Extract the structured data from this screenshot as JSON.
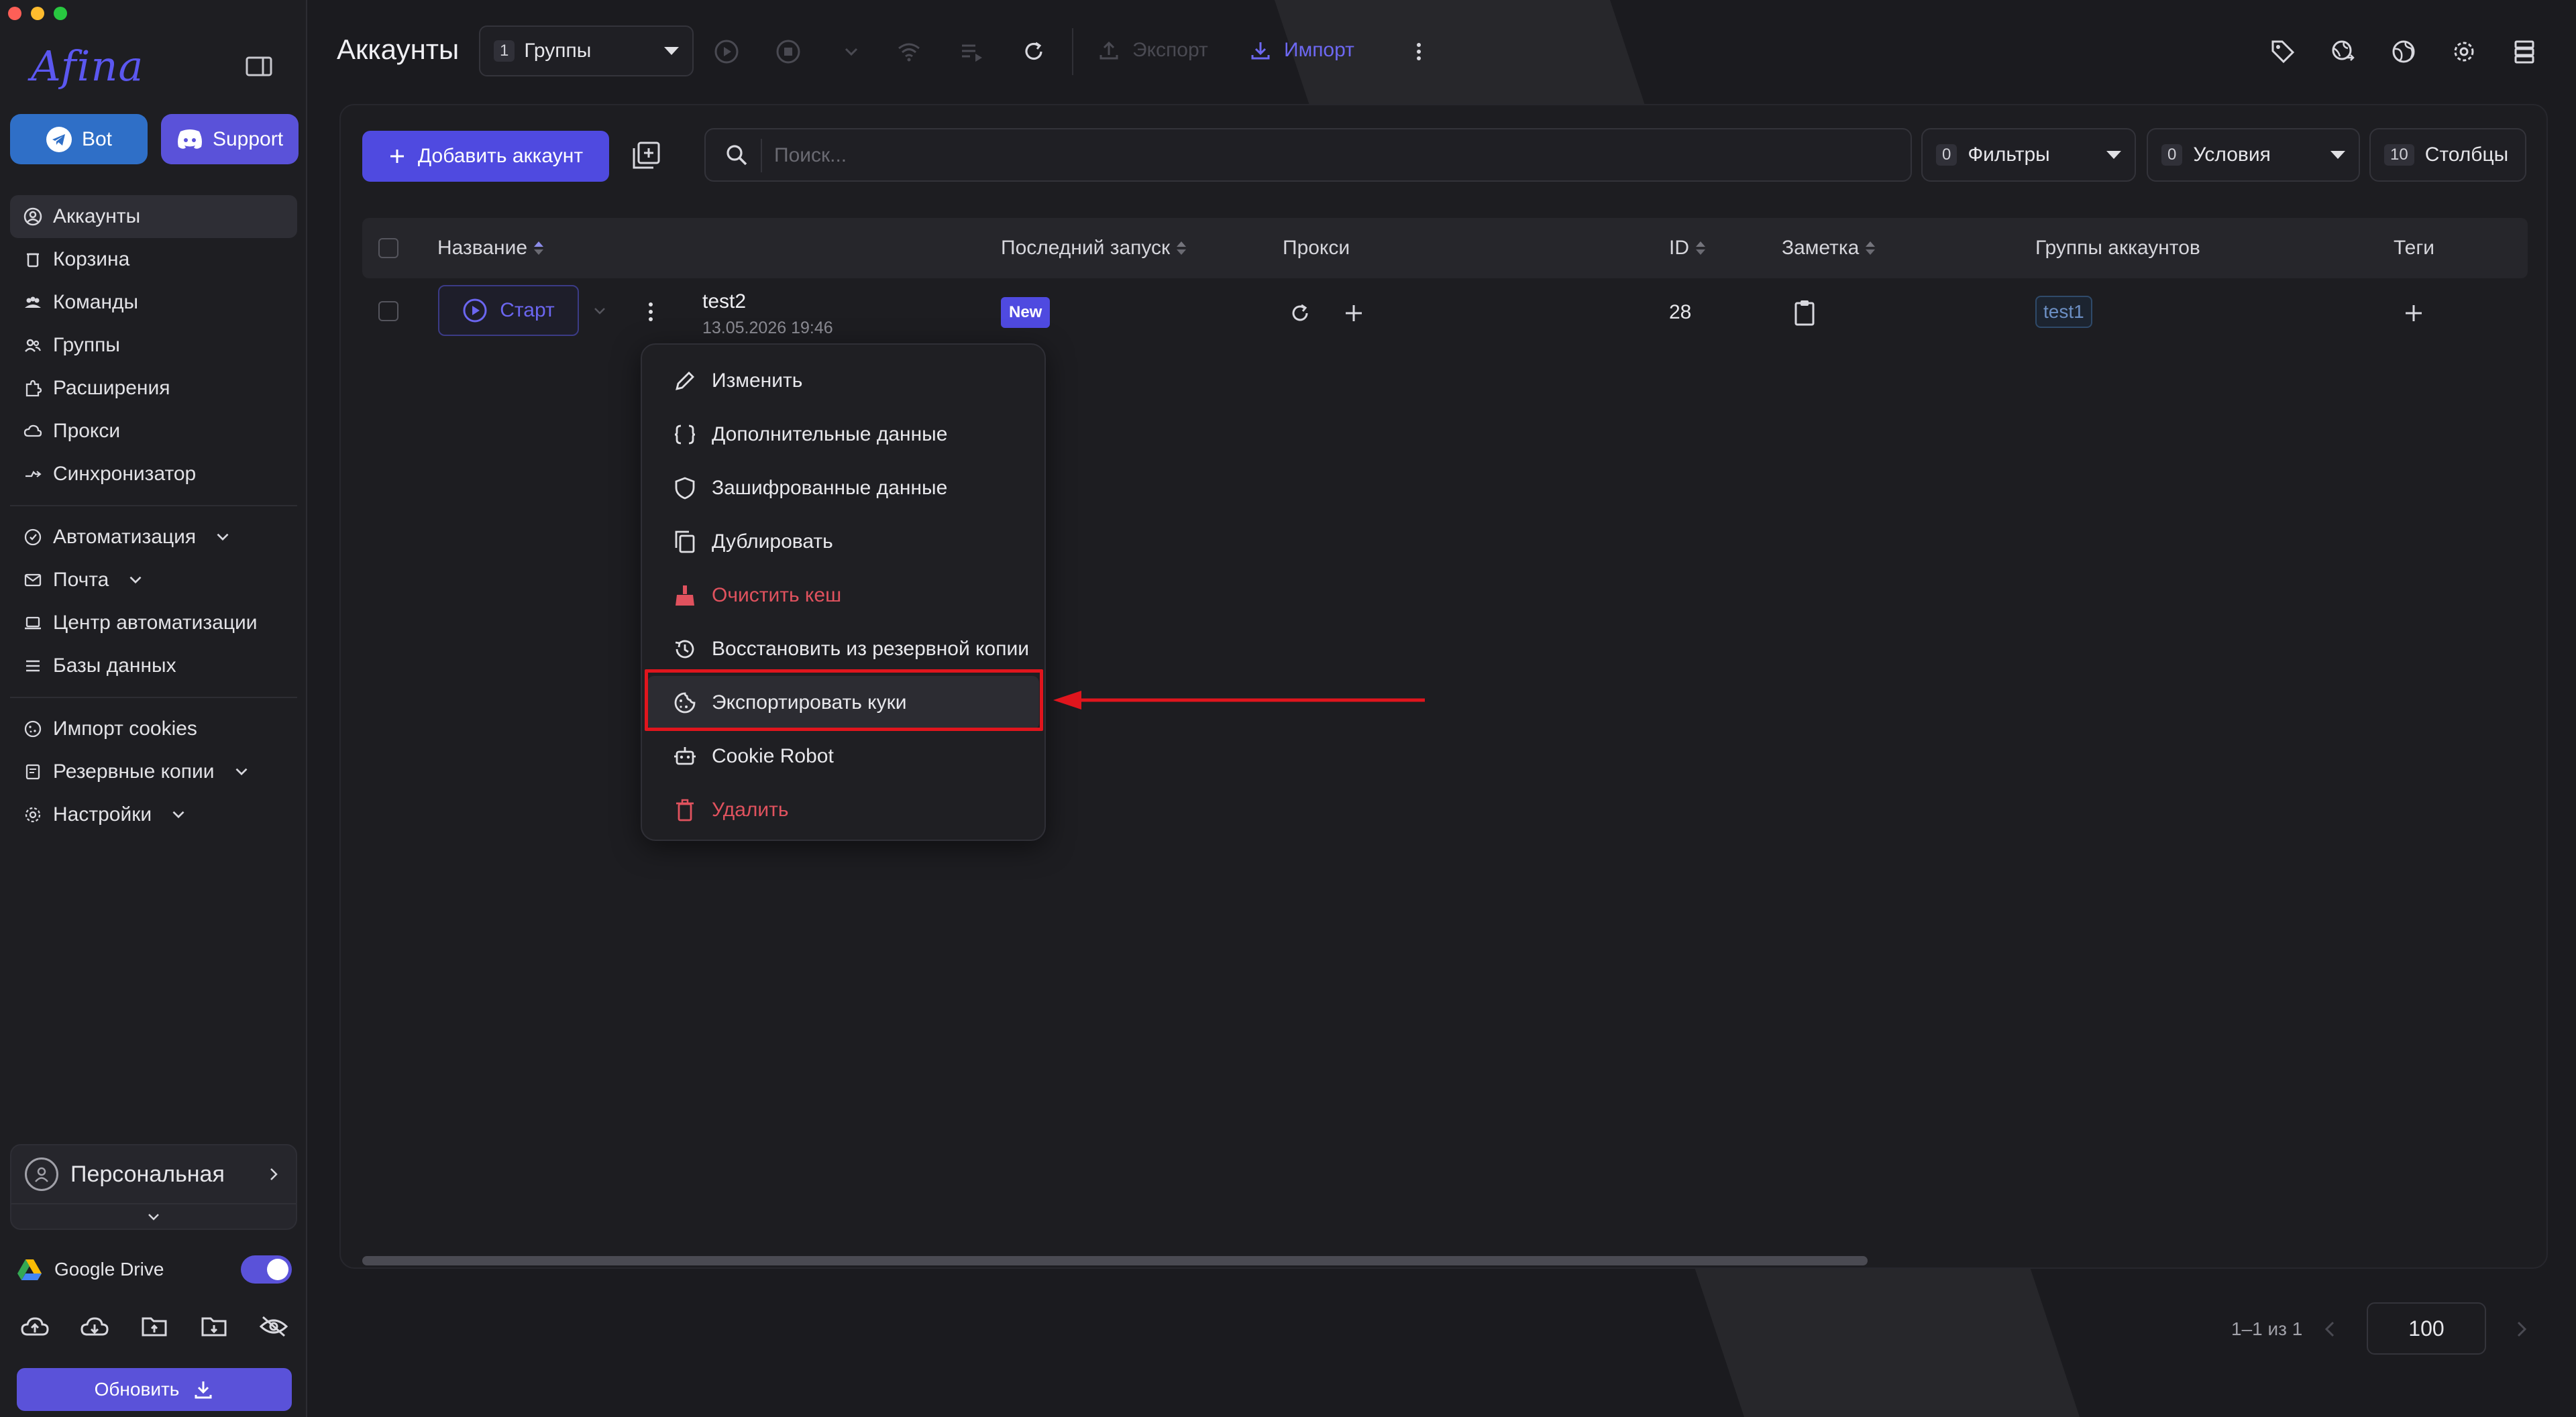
{
  "app": {
    "logo": "Afina"
  },
  "sidebar": {
    "bot_label": "Bot",
    "support_label": "Support",
    "items_main": [
      {
        "label": "Аккаунты"
      },
      {
        "label": "Корзина"
      },
      {
        "label": "Команды"
      },
      {
        "label": "Группы"
      },
      {
        "label": "Расширения"
      },
      {
        "label": "Прокси"
      },
      {
        "label": "Синхронизатор"
      }
    ],
    "items_auto": [
      {
        "label": "Автоматизация"
      },
      {
        "label": "Почта"
      },
      {
        "label": "Центр автоматизации"
      },
      {
        "label": "Базы данных"
      }
    ],
    "items_misc": [
      {
        "label": "Импорт cookies"
      },
      {
        "label": "Резервные копии"
      },
      {
        "label": "Настройки"
      }
    ],
    "workspace": "Персональная",
    "gdrive_label": "Google Drive",
    "gdrive_enabled": true,
    "update_label": "Обновить"
  },
  "header": {
    "title": "Аккаунты",
    "group_count": "1",
    "group_label": "Группы",
    "export_label": "Экспорт",
    "import_label": "Импорт"
  },
  "toolbar": {
    "add_label": "Добавить аккаунт",
    "search_placeholder": "Поиск...",
    "filters_count": "0",
    "filters_label": "Фильтры",
    "conditions_count": "0",
    "conditions_label": "Условия",
    "columns_count": "10",
    "columns_label": "Столбцы"
  },
  "table": {
    "headers": {
      "name": "Название",
      "last_run": "Последний запуск",
      "proxy": "Прокси",
      "id": "ID",
      "note": "Заметка",
      "groups": "Группы аккаунтов",
      "tags": "Теги"
    },
    "rows": [
      {
        "start_label": "Старт",
        "name": "test2",
        "date": "13.05.2026 19:46",
        "status": "New",
        "id": "28",
        "group": "test1"
      }
    ]
  },
  "context_menu": {
    "items": [
      {
        "label": "Изменить",
        "icon": "pencil-icon"
      },
      {
        "label": "Дополнительные данные",
        "icon": "braces-icon"
      },
      {
        "label": "Зашифрованные данные",
        "icon": "shield-icon"
      },
      {
        "label": "Дублировать",
        "icon": "copy-icon"
      },
      {
        "label": "Очистить кеш",
        "icon": "broom-icon",
        "danger": true
      },
      {
        "label": "Восстановить из резервной копии",
        "icon": "history-icon"
      },
      {
        "label": "Экспортировать куки",
        "icon": "cookie-icon",
        "highlighted": true
      },
      {
        "label": "Cookie Robot",
        "icon": "robot-icon"
      },
      {
        "label": "Удалить",
        "icon": "trash-icon",
        "danger": true
      }
    ]
  },
  "pagination": {
    "range": "1–1 из 1",
    "page_size": "100"
  },
  "colors": {
    "accent": "#4f4ae0",
    "danger": "#e0525e",
    "annotation": "#e0151d"
  }
}
